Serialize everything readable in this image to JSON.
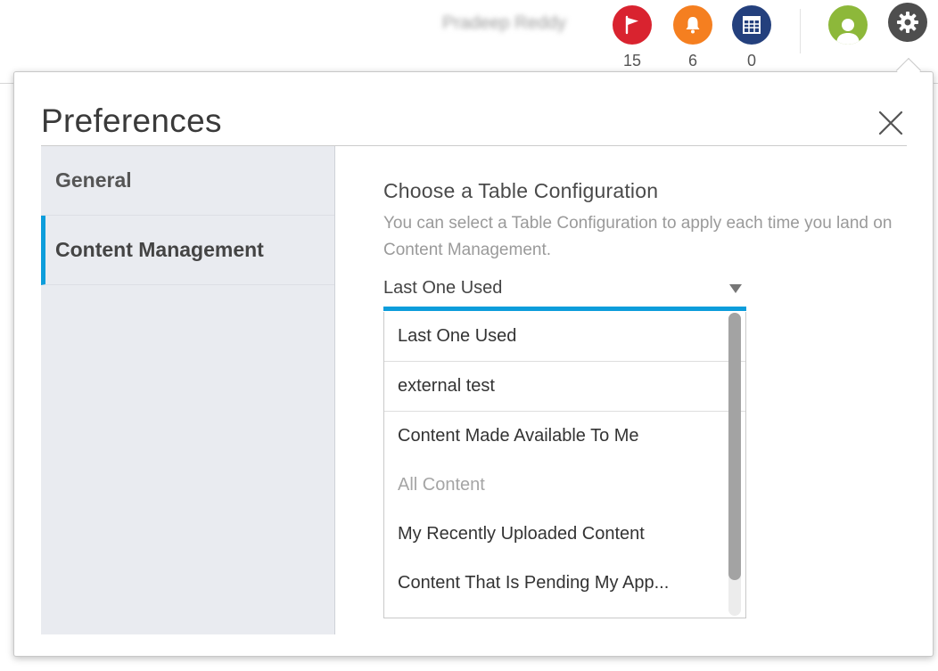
{
  "topbar": {
    "username": "Pradeep Reddy",
    "notifications": [
      {
        "icon": "flag-icon",
        "count": "15",
        "color": "#d9232f"
      },
      {
        "icon": "bell-icon",
        "count": "6",
        "color": "#f57f20"
      },
      {
        "icon": "calendar-grid-icon",
        "count": "0",
        "color": "#24407d"
      }
    ],
    "avatar_color": "#8db83a",
    "gear_color": "#4e4e4e"
  },
  "dialog": {
    "title": "Preferences",
    "sidebar": {
      "items": [
        {
          "label": "General",
          "active": false
        },
        {
          "label": "Content Management",
          "active": true
        }
      ]
    },
    "content": {
      "section_title": "Choose a Table Configuration",
      "description": "You can select a Table Configuration to apply each time you land on Content Management.",
      "select": {
        "selected": "Last One Used",
        "options": [
          {
            "label": "Last One Used",
            "disabled": false
          },
          {
            "label": "external test",
            "disabled": false
          },
          {
            "label": "Content Made Available To Me",
            "disabled": false
          },
          {
            "label": "All Content",
            "disabled": true
          },
          {
            "label": "My Recently Uploaded Content",
            "disabled": false
          },
          {
            "label": "Content That Is Pending My App...",
            "disabled": false
          }
        ]
      }
    }
  },
  "colors": {
    "accent": "#0d9ddb",
    "sidebar_bg": "#e9ebf0"
  }
}
